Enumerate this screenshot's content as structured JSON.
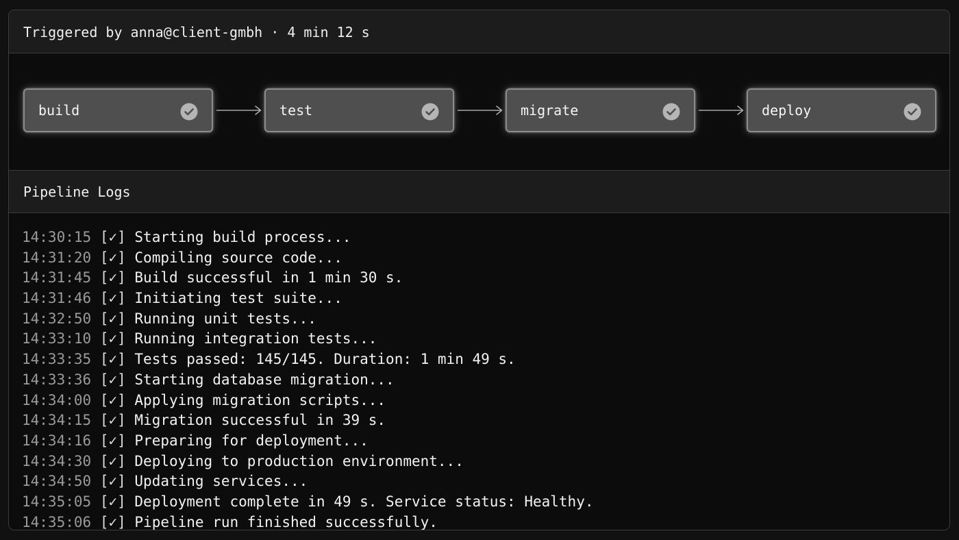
{
  "header": {
    "trigger_text": "Triggered by anna@client-gmbh · 4 min 12 s"
  },
  "pipeline": {
    "stages": [
      {
        "label": "build",
        "status": "success",
        "icon": "check-circle-icon"
      },
      {
        "label": "test",
        "status": "success",
        "icon": "check-circle-icon"
      },
      {
        "label": "migrate",
        "status": "success",
        "icon": "check-circle-icon"
      },
      {
        "label": "deploy",
        "status": "success",
        "icon": "check-circle-icon"
      }
    ]
  },
  "logs": {
    "title": "Pipeline Logs",
    "entries": [
      {
        "time": "14:30:15",
        "mark": "[✓]",
        "message": "Starting build process..."
      },
      {
        "time": "14:31:20",
        "mark": "[✓]",
        "message": "Compiling source code..."
      },
      {
        "time": "14:31:45",
        "mark": "[✓]",
        "message": "Build successful in 1 min 30 s."
      },
      {
        "time": "14:31:46",
        "mark": "[✓]",
        "message": "Initiating test suite..."
      },
      {
        "time": "14:32:50",
        "mark": "[✓]",
        "message": "Running unit tests..."
      },
      {
        "time": "14:33:10",
        "mark": "[✓]",
        "message": "Running integration tests..."
      },
      {
        "time": "14:33:35",
        "mark": "[✓]",
        "message": "Tests passed: 145/145. Duration: 1 min 49 s."
      },
      {
        "time": "14:33:36",
        "mark": "[✓]",
        "message": "Starting database migration..."
      },
      {
        "time": "14:34:00",
        "mark": "[✓]",
        "message": "Applying migration scripts..."
      },
      {
        "time": "14:34:15",
        "mark": "[✓]",
        "message": "Migration successful in 39 s."
      },
      {
        "time": "14:34:16",
        "mark": "[✓]",
        "message": "Preparing for deployment..."
      },
      {
        "time": "14:34:30",
        "mark": "[✓]",
        "message": "Deploying to production environment..."
      },
      {
        "time": "14:34:50",
        "mark": "[✓]",
        "message": "Updating services..."
      },
      {
        "time": "14:35:05",
        "mark": "[✓]",
        "message": "Deployment complete in 49 s. Service status: Healthy."
      },
      {
        "time": "14:35:06",
        "mark": "[✓]",
        "message": "Pipeline run finished successfully."
      }
    ]
  },
  "colors": {
    "background": "#111111",
    "header_bar": "#1c1c1c",
    "stage_fill": "#4f4f4f",
    "stage_border": "#8c8c8c",
    "check_circle": "#b5b5b5",
    "timestamp": "#9a9a9a",
    "text": "#f2f2f2"
  }
}
